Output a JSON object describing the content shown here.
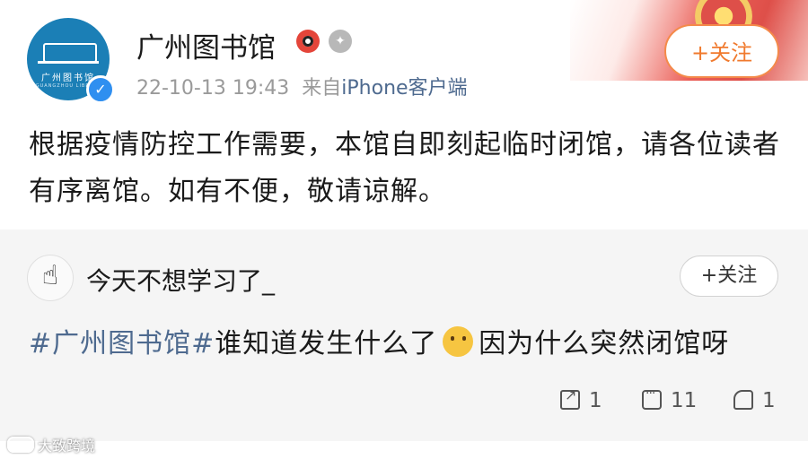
{
  "post": {
    "author_name": "广州图书馆",
    "avatar_caption": "广州图书馆",
    "avatar_caption_en": "GUANGZHOU LIBRARY",
    "timestamp": "22-10-13 19:43",
    "source_prefix": "来自",
    "source": "iPhone客户端",
    "follow_label": "+关注",
    "body": "根据疫情防控工作需要，本馆自即刻起临时闭馆，请各位读者有序离馆。如有不便，敬请谅解。"
  },
  "repost": {
    "author_name": "今天不想学习了_",
    "follow_label": "+关注",
    "hashtag": "#广州图书馆#",
    "text_before_emoji": "谁知道发生什么了",
    "emoji": "thinking-face",
    "text_after_emoji": "因为什么突然闭馆呀",
    "share_count": "1",
    "comment_count": "11",
    "like_count": "1"
  },
  "watermark": "大致跨境",
  "colors": {
    "follow_accent": "#f07a2e",
    "link_blue": "#4e6a8f",
    "verified_blue": "#2f8ff0",
    "avatar_blue": "#1b7fb6"
  }
}
